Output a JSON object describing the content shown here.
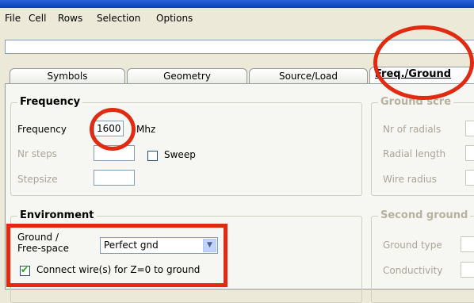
{
  "menu": {
    "items": [
      "File",
      "Cell",
      "Rows",
      "Selection",
      "Options"
    ]
  },
  "tabs": [
    {
      "label": "Symbols"
    },
    {
      "label": "Geometry"
    },
    {
      "label": "Source/Load"
    },
    {
      "label": "Freq./Ground"
    }
  ],
  "frequency": {
    "legend": "Frequency",
    "freq_label": "Frequency",
    "freq_value": "1600",
    "freq_unit": "Mhz",
    "nrsteps_label": "Nr steps",
    "nrsteps_value": "",
    "sweep_label": "Sweep",
    "sweep_checked": false,
    "stepsize_label": "Stepsize",
    "stepsize_value": ""
  },
  "ground_screen": {
    "legend": "Ground scre",
    "nr_radials_label": "Nr of radials",
    "radial_length_label": "Radial length",
    "wire_radius_label": "Wire radius"
  },
  "environment": {
    "legend": "Environment",
    "ground_label_line1": "Ground  /",
    "ground_label_line2": "Free-space",
    "ground_value": "Perfect gnd",
    "connect_label": "Connect wire(s) for Z=0 to ground",
    "connect_checked": true
  },
  "second_ground": {
    "legend": "Second ground",
    "ground_type_label": "Ground type",
    "conductivity_label": "Conductivity"
  },
  "annotation_color": "#e02b12"
}
